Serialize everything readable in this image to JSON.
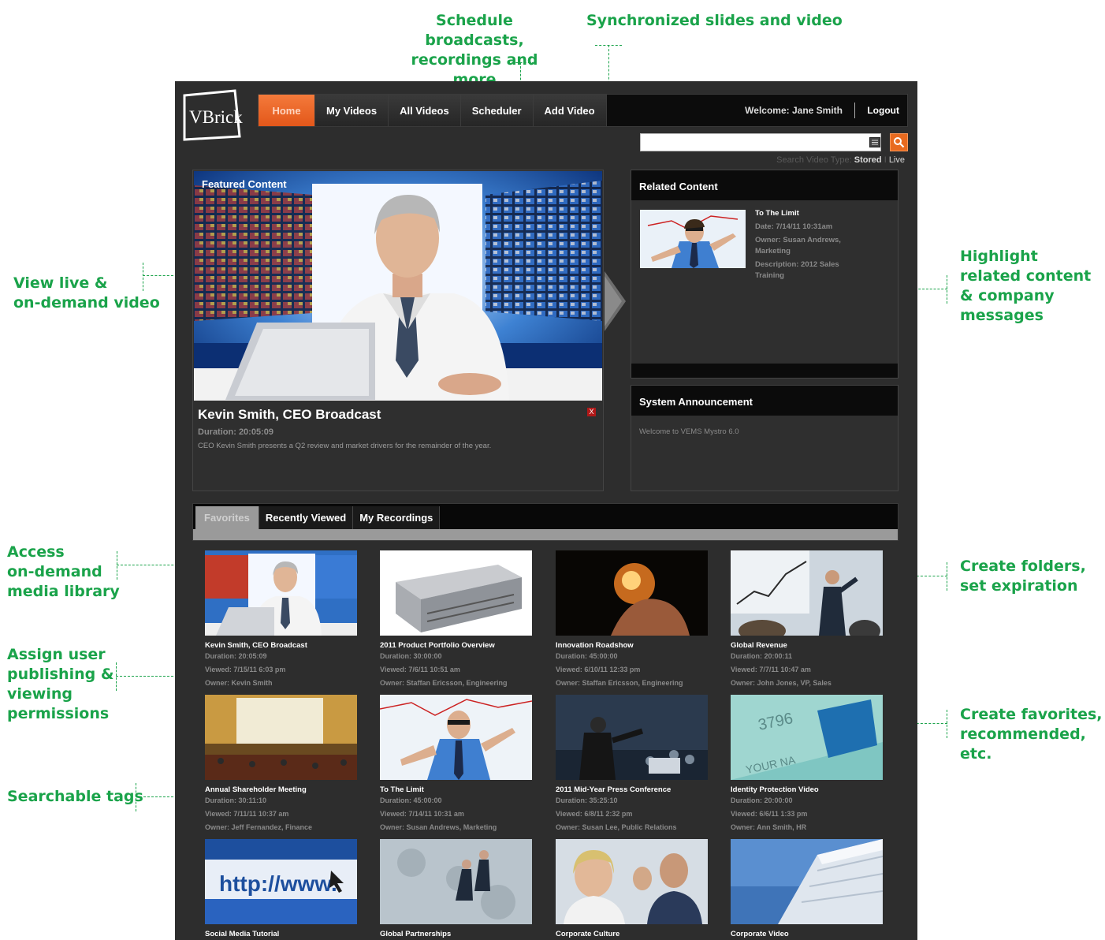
{
  "colors": {
    "callout": "#1aa34a",
    "accent": "#e86a1f",
    "background": "#2d2d2d"
  },
  "callouts": {
    "schedule": [
      "Schedule broadcasts,",
      "recordings and more"
    ],
    "sync": "Synchronized slides and video",
    "view_live": [
      "View live &",
      "on-demand video"
    ],
    "highlight": [
      "Highlight",
      "related content",
      "& company",
      "messages"
    ],
    "access": [
      "Access",
      "on-demand",
      "media library"
    ],
    "assign": [
      "Assign user",
      "publishing &",
      "viewing",
      "permissions"
    ],
    "searchable": "Searchable tags",
    "folders": [
      "Create folders,",
      "set expiration"
    ],
    "favorites": [
      "Create favorites,",
      "recommended, etc."
    ]
  },
  "logo": {
    "text": "VBrick"
  },
  "nav": {
    "tabs": [
      "Home",
      "My Videos",
      "All Videos",
      "Scheduler",
      "Add Video"
    ],
    "welcome": "Welcome: Jane Smith",
    "logout": "Logout"
  },
  "search": {
    "value": "",
    "type_label": "Search Video Type:",
    "type_stored": "Stored",
    "type_sep": "I",
    "type_live": "Live"
  },
  "featured": {
    "label": "Featured Content",
    "title": "Kevin Smith, CEO Broadcast",
    "duration": "Duration: 20:05:09",
    "description": "CEO Kevin Smith presents a Q2 review and market drivers for the remainder of the year.",
    "close": "X"
  },
  "related": {
    "heading": "Related Content",
    "title": "To The Limit",
    "date": "Date: 7/14/11 10:31am",
    "owner": "Owner: Susan Andrews, Marketing",
    "description": "Description: 2012 Sales Training"
  },
  "announcement": {
    "heading": "System Announcement",
    "text": "Welcome to VEMS Mystro 6.0"
  },
  "tabs": [
    "Favorites",
    "Recently Viewed",
    "My Recordings"
  ],
  "videos": [
    {
      "title": "Kevin Smith, CEO Broadcast",
      "duration": "Duration: 20:05:09",
      "viewed": "Viewed: 7/15/11 6:03 pm",
      "owner": "Owner: Kevin Smith",
      "thumb": "ceo-broadcast"
    },
    {
      "title": "2011 Product Portfolio Overview",
      "duration": "Duration: 30:00:00",
      "viewed": "Viewed: 7/6/11 10:51 am",
      "owner": "Owner: Staffan Ericsson, Engineering",
      "thumb": "server"
    },
    {
      "title": "Innovation Roadshow",
      "duration": "Duration: 45:00:00",
      "viewed": "Viewed: 6/10/11 12:33 pm",
      "owner": "Owner: Staffan Ericsson, Engineering",
      "thumb": "lightbulb"
    },
    {
      "title": "Global Revenue",
      "duration": "Duration: 20:00:11",
      "viewed": "Viewed: 7/7/11 10:47 am",
      "owner": "Owner: John Jones, VP, Sales",
      "thumb": "presentation"
    },
    {
      "title": "Annual Shareholder Meeting",
      "duration": "Duration: 30:11:10",
      "viewed": "Viewed: 7/11/11 10:37 am",
      "owner": "Owner: Jeff Fernandez, Finance",
      "thumb": "auditorium"
    },
    {
      "title": "To The Limit",
      "duration": "Duration: 45:00:00",
      "viewed": "Viewed: 7/14/11 10:31 am",
      "owner": "Owner: Susan Andrews, Marketing",
      "thumb": "chart-man"
    },
    {
      "title": "2011 Mid-Year Press Conference",
      "duration": "Duration: 35:25:10",
      "viewed": "Viewed: 6/8/11 2:32 pm",
      "owner": "Owner: Susan Lee, Public Relations",
      "thumb": "speaker"
    },
    {
      "title": "Identity Protection Video",
      "duration": "Duration: 20:00:00",
      "viewed": "Viewed: 6/6/11 1:33 pm",
      "owner": "Owner: Ann Smith, HR",
      "thumb": "credit-card"
    },
    {
      "title": "Social Media Tutorial",
      "duration": "",
      "viewed": "",
      "owner": "",
      "thumb": "http",
      "url_text": "http://www."
    },
    {
      "title": "Global Partnerships",
      "duration": "",
      "viewed": "",
      "owner": "",
      "thumb": "walkers"
    },
    {
      "title": "Corporate Culture",
      "duration": "",
      "viewed": "",
      "owner": "",
      "thumb": "people"
    },
    {
      "title": "Corporate Video",
      "duration": "",
      "viewed": "",
      "owner": "",
      "thumb": "building"
    }
  ]
}
